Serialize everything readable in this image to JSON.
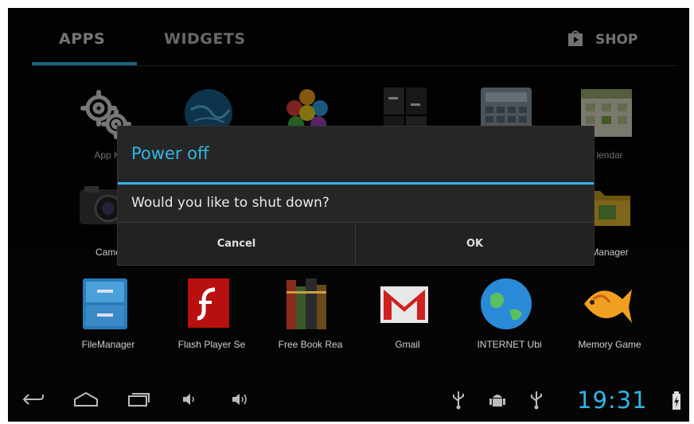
{
  "tabs": {
    "apps": "APPS",
    "widgets": "WIDGETS",
    "shop": "SHOP"
  },
  "apps": [
    {
      "label": "App Ki",
      "icon": "settings-gears-icon"
    },
    {
      "label": "",
      "icon": "globe-icon"
    },
    {
      "label": "",
      "icon": "colored-balls-icon"
    },
    {
      "label": "",
      "icon": "calculator-icon"
    },
    {
      "label": "",
      "icon": "calculator-icon"
    },
    {
      "label": "lendar",
      "icon": "calendar-icon"
    },
    {
      "label": "Came",
      "icon": "camera-icon"
    },
    {
      "label": "Manager",
      "icon": "folder-icon"
    },
    {
      "label": "FileManager",
      "icon": "file-cabinet-icon"
    },
    {
      "label": "Flash Player Se",
      "icon": "flash-icon"
    },
    {
      "label": "Free Book Rea",
      "icon": "books-icon"
    },
    {
      "label": "Gmail",
      "icon": "gmail-icon"
    },
    {
      "label": "INTERNET Ubi",
      "icon": "earth-icon"
    },
    {
      "label": "Memory Game",
      "icon": "fish-icon"
    }
  ],
  "dialog": {
    "title": "Power off",
    "message": "Would you like to shut down?",
    "cancel": "Cancel",
    "ok": "OK"
  },
  "statusbar": {
    "time": "19:31"
  },
  "colors": {
    "accent": "#33b5e5",
    "background": "#050505",
    "dialog": "#262626"
  }
}
